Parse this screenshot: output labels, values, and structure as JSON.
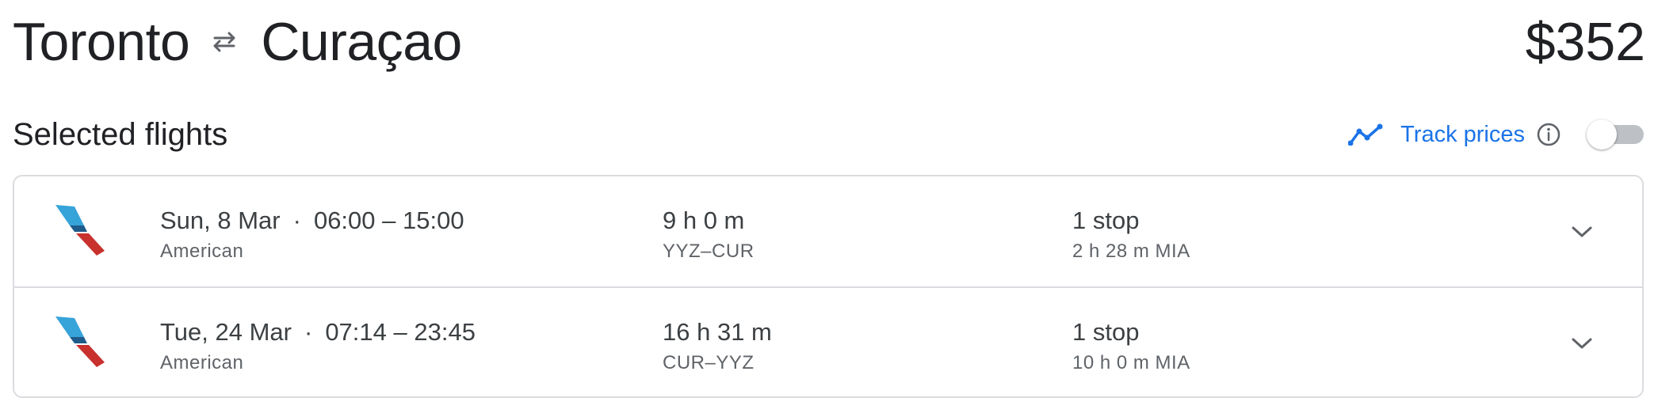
{
  "header": {
    "origin": "Toronto",
    "destination": "Curaçao",
    "swap_icon": "round-trip-arrows-icon",
    "total_price": "$352"
  },
  "subheader": {
    "title": "Selected flights",
    "track_prices_label": "Track prices",
    "track_icon": "trending-line-icon",
    "info_icon": "info-icon",
    "toggle_state": "off"
  },
  "flights": [
    {
      "date": "Sun, 8 Mar",
      "separator": "·",
      "times": "06:00 – 15:00",
      "airline": "American",
      "duration": "9 h 0 m",
      "route": "YYZ–CUR",
      "stops": "1 stop",
      "layover": "2 h 28 m MIA"
    },
    {
      "date": "Tue, 24 Mar",
      "separator": "·",
      "times": "07:14 – 23:45",
      "airline": "American",
      "duration": "16 h 31 m",
      "route": "CUR–YYZ",
      "stops": "1 stop",
      "layover": "10 h 0 m MIA"
    }
  ],
  "colors": {
    "accent": "#1a73e8",
    "border": "#dadce0",
    "text_primary": "#202124",
    "text_secondary": "#5f6368",
    "logo_blue": "#36a3d9",
    "logo_red": "#c8312d"
  }
}
